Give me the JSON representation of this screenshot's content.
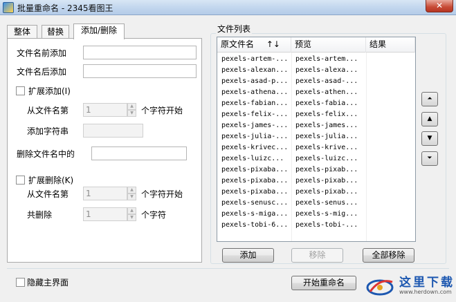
{
  "window": {
    "title": "批量重命名 - 2345看图王",
    "close_glyph": "✕"
  },
  "tabs": [
    "整体",
    "替换",
    "添加/删除"
  ],
  "form": {
    "prefix_label": "文件名前添加",
    "suffix_label": "文件名后添加",
    "ext_add_label": "扩展添加(I)",
    "from_pos_label": "从文件名第",
    "from_pos_value": "1",
    "char_start_label": "个字符开始",
    "add_string_label": "添加字符串",
    "delete_in_label": "删除文件名中的",
    "ext_del_label": "扩展删除(K)",
    "from_pos2_label": "从文件名第",
    "from_pos2_value": "1",
    "char_start2_label": "个字符开始",
    "total_del_label": "共删除",
    "total_del_value": "1",
    "chars_label": "个字符"
  },
  "file_list": {
    "caption": "文件列表",
    "columns": {
      "original": "原文件名",
      "sort_icons": "↑↓",
      "preview": "预览",
      "result": "结果"
    },
    "rows": [
      {
        "original": "pexels-artem-...",
        "preview": "pexels-artem..."
      },
      {
        "original": "pexels-alexan...",
        "preview": "pexels-alexa..."
      },
      {
        "original": "pexels-asad-p...",
        "preview": "pexels-asad-..."
      },
      {
        "original": "pexels-athena...",
        "preview": "pexels-athen..."
      },
      {
        "original": "pexels-fabian...",
        "preview": "pexels-fabia..."
      },
      {
        "original": "pexels-felix-...",
        "preview": "pexels-felix..."
      },
      {
        "original": "pexels-james-...",
        "preview": "pexels-james..."
      },
      {
        "original": "pexels-julia-...",
        "preview": "pexels-julia..."
      },
      {
        "original": "pexels-krivec...",
        "preview": "pexels-krive..."
      },
      {
        "original": "pexels-luizc...",
        "preview": "pexels-luizc..."
      },
      {
        "original": "pexels-pixaba...",
        "preview": "pexels-pixab..."
      },
      {
        "original": "pexels-pixaba...",
        "preview": "pexels-pixab..."
      },
      {
        "original": "pexels-pixaba...",
        "preview": "pexels-pixab..."
      },
      {
        "original": "pexels-senusc...",
        "preview": "pexels-senus..."
      },
      {
        "original": "pexels-s-miga...",
        "preview": "pexels-s-mig..."
      },
      {
        "original": "pexels-tobi-6...",
        "preview": "pexels-tobi-..."
      }
    ],
    "add_button": "添加",
    "remove_button": "移除",
    "remove_all_button": "全部移除"
  },
  "side_buttons": {
    "top": "⏶",
    "up": "▲",
    "down": "▼",
    "bottom": "⏷"
  },
  "footer": {
    "hide_main_label": "隐藏主界面",
    "start_button": "开始重命名",
    "watermark_text": "这里下载",
    "watermark_url": "www.herdown.com"
  },
  "colors": {
    "accent": "#1c57b0",
    "close": "#c74a35"
  }
}
